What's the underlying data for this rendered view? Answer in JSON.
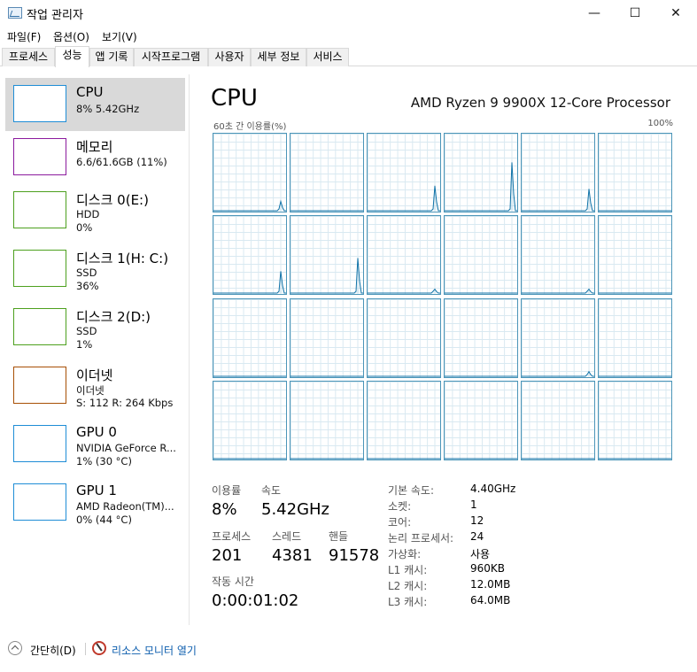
{
  "window": {
    "title": "작업 관리자",
    "minimize": "—",
    "maximize": "☐",
    "close": "✕"
  },
  "menu": [
    "파일(F)",
    "옵션(O)",
    "보기(V)"
  ],
  "tabs": [
    "프로세스",
    "성능",
    "앱 기록",
    "시작프로그램",
    "사용자",
    "세부 정보",
    "서비스"
  ],
  "active_tab": "성능",
  "sidebar": {
    "items": [
      {
        "title": "CPU",
        "line1": "8% 5.42GHz",
        "line2": "",
        "color": "#1f8dd6",
        "selected": true
      },
      {
        "title": "메모리",
        "line1": "6.6/61.6GB (11%)",
        "line2": "",
        "color": "#8b1a9e",
        "selected": false
      },
      {
        "title": "디스크 0(E:)",
        "line1": "HDD",
        "line2": "0%",
        "color": "#4da01e",
        "selected": false
      },
      {
        "title": "디스크 1(H: C:)",
        "line1": "SSD",
        "line2": "36%",
        "color": "#4da01e",
        "selected": false
      },
      {
        "title": "디스크 2(D:)",
        "line1": "SSD",
        "line2": "1%",
        "color": "#4da01e",
        "selected": false
      },
      {
        "title": "이더넷",
        "line1": "이더넷",
        "line2": "S: 112  R: 264 Kbps",
        "color": "#a74f04",
        "selected": false
      },
      {
        "title": "GPU 0",
        "line1": "NVIDIA GeForce R...",
        "line2": "1% (30 °C)",
        "color": "#1f8dd6",
        "selected": false
      },
      {
        "title": "GPU 1",
        "line1": "AMD Radeon(TM)...",
        "line2": "0% (44 °C)",
        "color": "#1f8dd6",
        "selected": false
      }
    ]
  },
  "main": {
    "title": "CPU",
    "model": "AMD Ryzen 9 9900X 12-Core Processor",
    "graph_label": "60초 간 이용률(%)",
    "graph_max": "100%",
    "graph_color": "#1173a8",
    "core_count": 24,
    "core_spikes": [
      {
        "core": 0,
        "peaks": [
          0.12
        ]
      },
      {
        "core": 2,
        "peaks": [
          0.32
        ]
      },
      {
        "core": 3,
        "peaks": [
          0.62
        ]
      },
      {
        "core": 4,
        "peaks": [
          0.28
        ]
      },
      {
        "core": 6,
        "peaks": [
          0.28
        ]
      },
      {
        "core": 7,
        "peaks": [
          0.45
        ]
      },
      {
        "core": 8,
        "peaks": [
          0.05
        ]
      },
      {
        "core": 10,
        "peaks": [
          0.05
        ]
      },
      {
        "core": 16,
        "peaks": [
          0.06
        ]
      }
    ],
    "stats": {
      "utilization_label": "이용률",
      "utilization": "8%",
      "speed_label": "속도",
      "speed": "5.42GHz",
      "processes_label": "프로세스",
      "processes": "201",
      "threads_label": "스레드",
      "threads": "4381",
      "handles_label": "핸들",
      "handles": "91578",
      "uptime_label": "작동 시간",
      "uptime": "0:00:01:02"
    },
    "info": [
      {
        "key": "기본 속도:",
        "value": "4.40GHz"
      },
      {
        "key": "소켓:",
        "value": "1"
      },
      {
        "key": "코어:",
        "value": "12"
      },
      {
        "key": "논리 프로세서:",
        "value": "24"
      },
      {
        "key": "가상화:",
        "value": "사용"
      },
      {
        "key": "L1 캐시:",
        "value": "960KB"
      },
      {
        "key": "L2 캐시:",
        "value": "12.0MB"
      },
      {
        "key": "L3 캐시:",
        "value": "64.0MB"
      }
    ]
  },
  "footer": {
    "collapse": "간단히(D)",
    "resource_monitor": "리소스 모니터 열기"
  }
}
